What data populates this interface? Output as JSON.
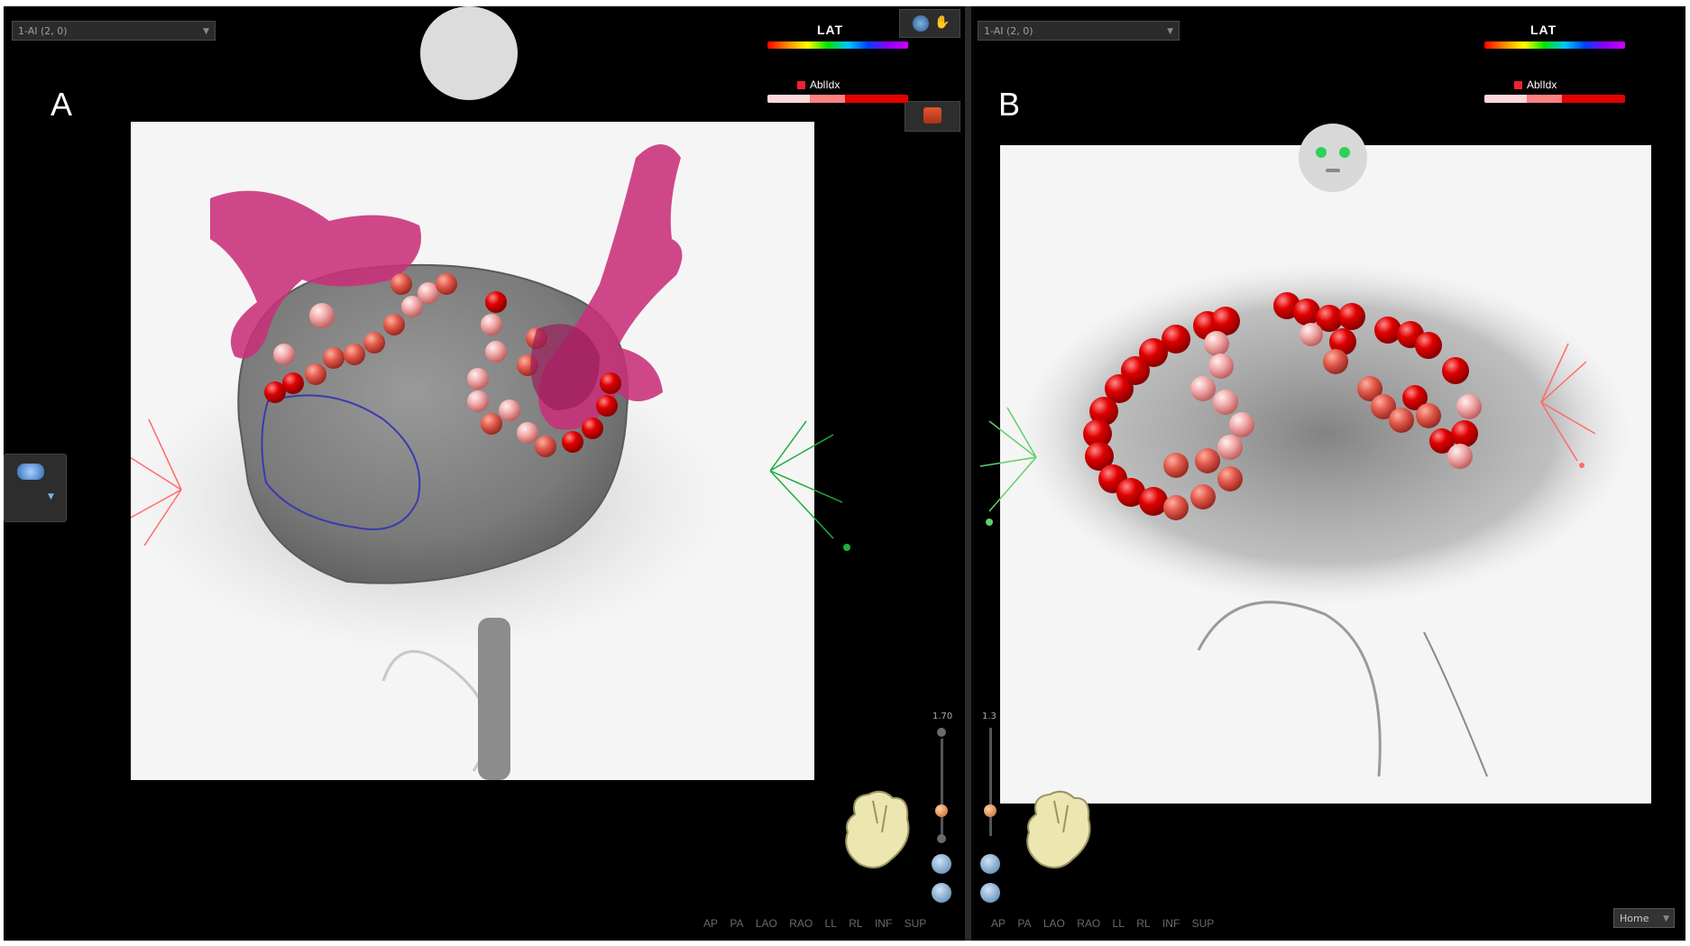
{
  "panel_a": {
    "letter": "A",
    "map_selector": "1-AI (2, 0)",
    "lat_label": "LAT",
    "ablation_label": "AblIdx",
    "zoom_value": "1.70"
  },
  "panel_b": {
    "letter": "B",
    "map_selector": "1-AI (2, 0)",
    "lat_label": "LAT",
    "ablation_label": "AblIdx",
    "zoom_value": "1.3",
    "home_button": "Home"
  },
  "view_buttons": [
    "AP",
    "PA",
    "LAO",
    "RAO",
    "LL",
    "RL",
    "INF",
    "SUP"
  ],
  "colors": {
    "ablation_red": "#e00000",
    "vein_magenta": "#c8307a",
    "chamber_gray": "#7d7d7d",
    "background": "#000000"
  }
}
